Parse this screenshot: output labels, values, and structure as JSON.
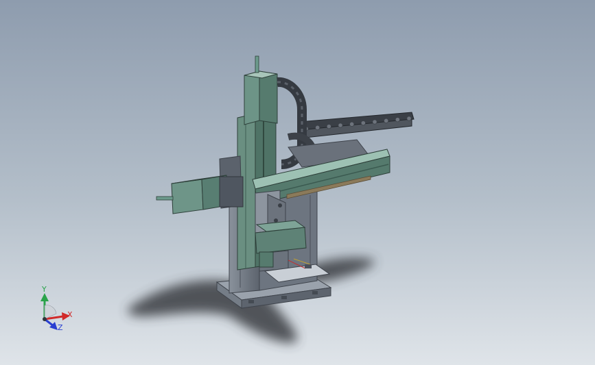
{
  "viewport": {
    "background_top": "#8e9cae",
    "background_mid": "#b4bfca",
    "background_bottom": "#dfe4e9"
  },
  "model": {
    "colors": {
      "teal": "#587e72",
      "teal_light": "#7fa597",
      "teal_dark": "#3b5a50",
      "frame_gray": "#6f7784",
      "frame_light": "#9ca4ae",
      "frame_dark": "#4a505a",
      "chain": "#3c4148",
      "chain_light": "#6d737c",
      "rail_brown": "#8b7a5a",
      "shadow": "#3f4247"
    }
  },
  "triad": {
    "x_label": "X",
    "y_label": "Y",
    "z_label": "Z",
    "x_color": "#d12a2a",
    "y_color": "#2aa34a",
    "z_color": "#2a3fd1"
  }
}
